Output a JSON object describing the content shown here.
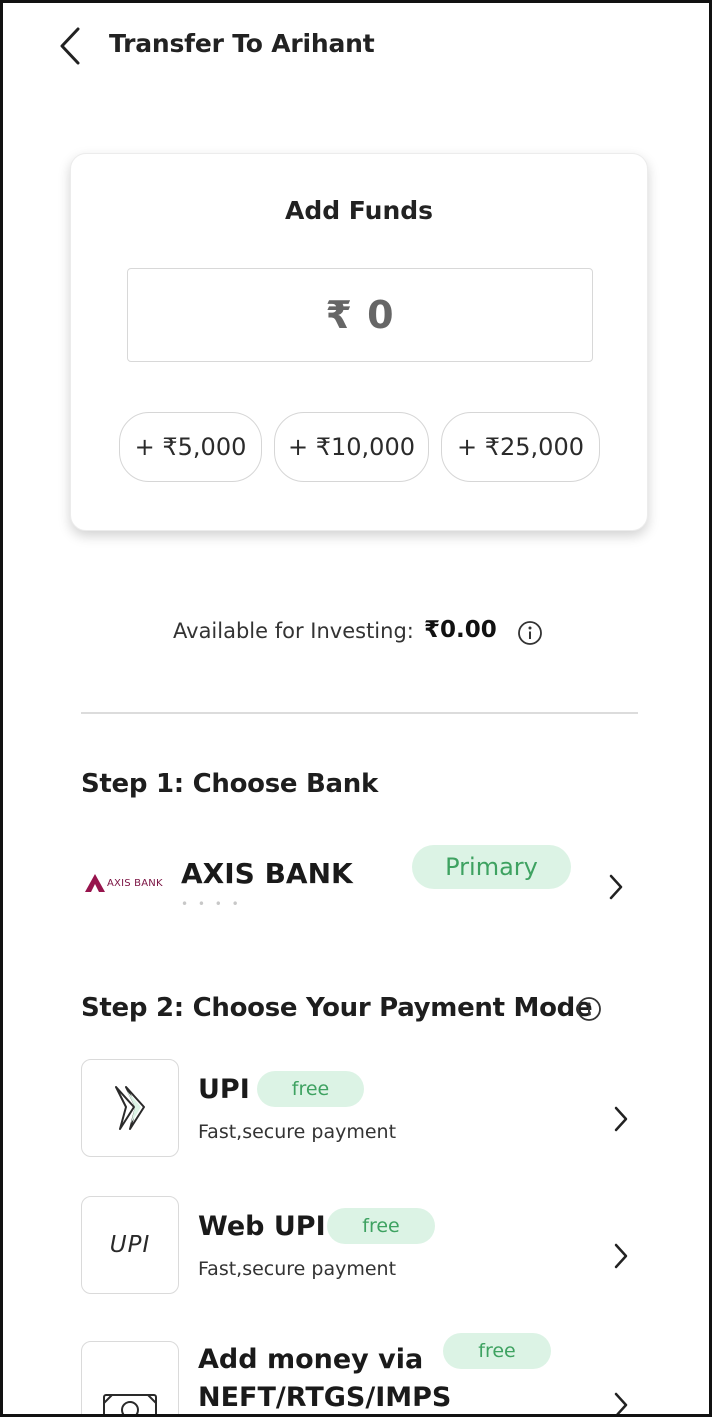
{
  "header": {
    "title": "Transfer To Arihant"
  },
  "add_funds": {
    "title": "Add Funds",
    "amount_value": "₹ 0",
    "quick_add": [
      {
        "label": "+ ₹5,000"
      },
      {
        "label": "+ ₹10,000"
      },
      {
        "label": "+ ₹25,000"
      }
    ]
  },
  "available": {
    "label": "Available for Investing:",
    "amount": "₹0.00"
  },
  "step1": {
    "title": "Step 1: Choose Bank",
    "bank": {
      "logo_text": "AXIS BANK",
      "name": "AXIS BANK",
      "account_masked": "• • • •",
      "badge": "Primary"
    }
  },
  "step2": {
    "title": "Step 2: Choose Your Payment Mode",
    "modes": [
      {
        "title": "UPI",
        "badge": "free",
        "subtitle": "Fast,secure payment",
        "icon": "upi-arrow-icon"
      },
      {
        "title": "Web UPI",
        "badge": "free",
        "subtitle": "Fast,secure payment",
        "icon": "upi-text-logo",
        "icon_text": "UPI"
      },
      {
        "title_line1": "Add money via",
        "title_line2": "NEFT/RTGS/IMPS",
        "badge": "free",
        "icon": "banknote-icon"
      }
    ]
  },
  "colors": {
    "accent_green": "#3ea261",
    "badge_bg": "#dcf3e5",
    "axis_brand": "#97144d"
  }
}
